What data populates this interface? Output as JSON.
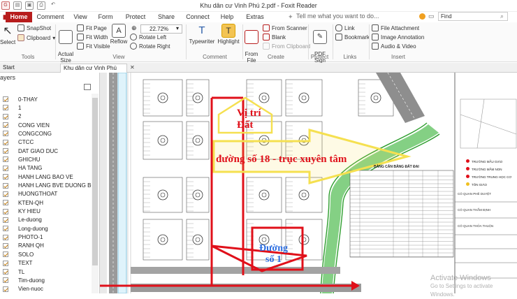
{
  "window": {
    "title": "Khu dân cư Vinh Phú 2.pdf - Foxit Reader"
  },
  "menu": {
    "items": [
      "Home",
      "Comment",
      "View",
      "Form",
      "Protect",
      "Share",
      "Connect",
      "Help",
      "Extras"
    ],
    "active": "Home",
    "tell_me": "Tell me what you want to do...",
    "find_placeholder": "Find"
  },
  "ribbon": {
    "tools": {
      "select": "Select",
      "snapshot": "SnapShot",
      "clipboard": "Clipboard",
      "group": "Tools"
    },
    "view": {
      "actual_size": "Actual\nSize",
      "fit_page": "Fit Page",
      "fit_width": "Fit Width",
      "fit_visible": "Fit Visible",
      "reflow": "Reflow",
      "zoom": "22.72%",
      "rotate_left": "Rotate Left",
      "rotate_right": "Rotate Right",
      "group": "View"
    },
    "comment": {
      "typewriter": "Typewriter",
      "highlight": "Highlight",
      "group": "Comment"
    },
    "create": {
      "from_file": "From\nFile",
      "from_scanner": "From Scanner",
      "blank": "Blank",
      "from_clipboard": "From Clipboard",
      "group": "Create"
    },
    "protect": {
      "pdf_sign": "PDF\nSign",
      "group": "Protect"
    },
    "links": {
      "link": "Link",
      "bookmark": "Bookmark",
      "group": "Links"
    },
    "insert": {
      "file_attachment": "File Attachment",
      "image_annotation": "Image Annotation",
      "audio_video": "Audio & Video",
      "group": "Insert"
    }
  },
  "tabs": {
    "start": "Start",
    "document": "Khu dân cư Vinh Phú 2..."
  },
  "layers": {
    "title": "ayers",
    "items": [
      "0-THAY",
      "1",
      "2",
      "CONG VIEN",
      "CONGCONG",
      "CTCC",
      "DAT GIAO DUC",
      "GHICHU",
      "HA TANG",
      "HANH LANG BAO VE",
      "HANH LANG BVE DUONG BO",
      "HUONGTHOAT",
      "KTEN-QH",
      "KY HIEU",
      "Le-duong",
      "Long-duong",
      "PHOTO-1",
      "RANH QH",
      "SOLO",
      "TEXT",
      "TL",
      "Tim-duong",
      "Vien-nuoc"
    ]
  },
  "annotations": {
    "site_line1": "Vị trí",
    "site_line2": "Đất",
    "road18": "đường số 18 - trục xuyên tâm",
    "road1_line1": "Đường",
    "road1_line2": "số 1"
  },
  "map": {
    "table_title": "BẢNG CÂN BẰNG ĐẤT ĐAI",
    "legend": [
      "TRƯỜNG MẪU GIÁO",
      "TRƯỜNG MẦM NON",
      "TRƯỜNG TRUNG HỌC CƠ",
      "TÔN GIÁO"
    ],
    "labels": [
      "CÓ QUAN PHÊ DUYỆT",
      "CÓ QUAN THẨM ĐỊNH",
      "CÓ QUAN THỎA THUẬN"
    ]
  },
  "watermark": {
    "line1": "Activate Windows",
    "line2": "Go to Settings to activate Windows."
  },
  "colors": {
    "accent": "#b71c1c",
    "annotation_red": "#e0101a",
    "annotation_blue": "#2b6de0",
    "arrow_yellow": "#f5e050",
    "river_green": "#3fbf3f"
  }
}
